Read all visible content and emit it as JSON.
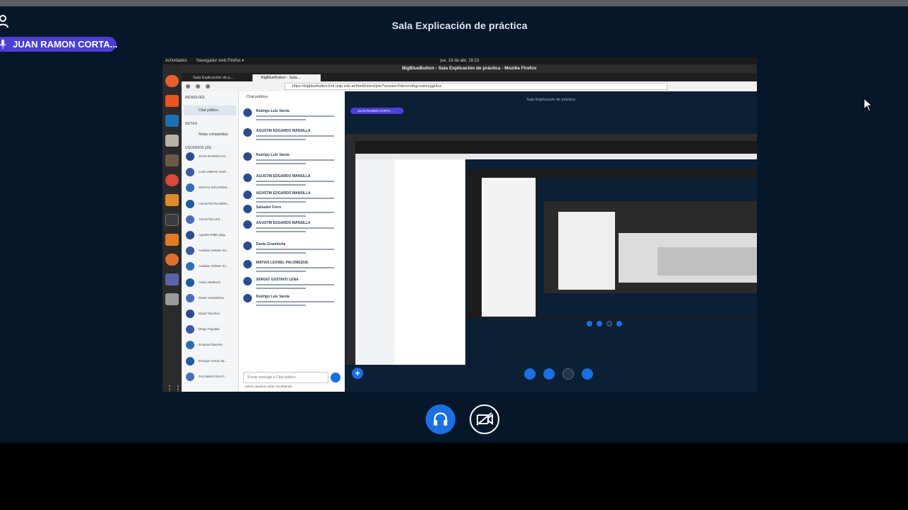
{
  "room": {
    "title": "Sala Explicación de práctica"
  },
  "talking": {
    "name": "JUAN RAMON CORTA..."
  },
  "shared_screen": {
    "ubuntu_bar": {
      "activities": "Actividades",
      "app_menu": "Navegador web Firefox ▾",
      "clock": "jue, 16 de abr, 18:23"
    },
    "window_title": "BigBlueButton - Sala Explicación de práctica - Mozilla Firefox",
    "tabs": [
      "Sala Explicación de p...",
      "BigBlueButton - Sala..."
    ],
    "url": "https://bigbluebutton.linti.unlp.edu.ar/html5client/join?sessionToken=xthgcsalercgg/3ca",
    "users_panel": {
      "messages_heading": "MENSAJES",
      "public_chat": "Chat público",
      "notes_heading": "NOTAS",
      "shared_notes": "Notas compartidas",
      "users_heading": "USUARIOS (29)",
      "users": [
        "JUAN RAMON CO...",
        "LUIS OMPAR GAR...",
        "MATIAS EDUARDO...",
        "AGUSTIN PALMIRA...",
        "AGUSTIN LEO...",
        "Agustin Pablo Bag...",
        "Ariadna Celeste Sa...",
        "Ariadna Celeste Sc...",
        "Arturo Matheus",
        "Dante Grambicha",
        "David Sanchez",
        "Diego Fayolski",
        "Emanuel Barreto",
        "Enrique Asmar Sa...",
        "FACUNDO DELFI..."
      ]
    },
    "chat": {
      "header": "Chat público",
      "messages": [
        {
          "author": "Rodrigo Luis Varela"
        },
        {
          "author": "AGUSTIN EDGARDO MANSILLA"
        },
        {
          "author": "Rodrigo Luis Varela"
        },
        {
          "author": "AGUSTIN EDGARDO MANSILLA"
        },
        {
          "author": "AGUSTIN EDGARDO MANSILLA"
        },
        {
          "author": "Salvador Ferro"
        },
        {
          "author": "AGUSTIN EDGARDO MANSILLA"
        },
        {
          "author": "Dante Grambicha"
        },
        {
          "author": "MATIAS LEONEL PALOMEQUE"
        },
        {
          "author": "SERGIO GUSTAVO LENA"
        },
        {
          "author": "Rodrigo Luis Varela"
        }
      ],
      "input_placeholder": "Enviar mensaje a Chat público",
      "typing": "varios usuarios están escribiendo"
    },
    "inner": {
      "title": "Sala Explicación de práctica",
      "talker": "JUAN RAMON CORTA..."
    }
  },
  "colors": {
    "background": "#06172a",
    "accent": "#1b6fe0",
    "talker": "#4a3fd6"
  },
  "icons": {
    "audio": "headphones-icon",
    "video": "video-off-icon",
    "user": "user-icon",
    "mic": "microphone-icon"
  }
}
